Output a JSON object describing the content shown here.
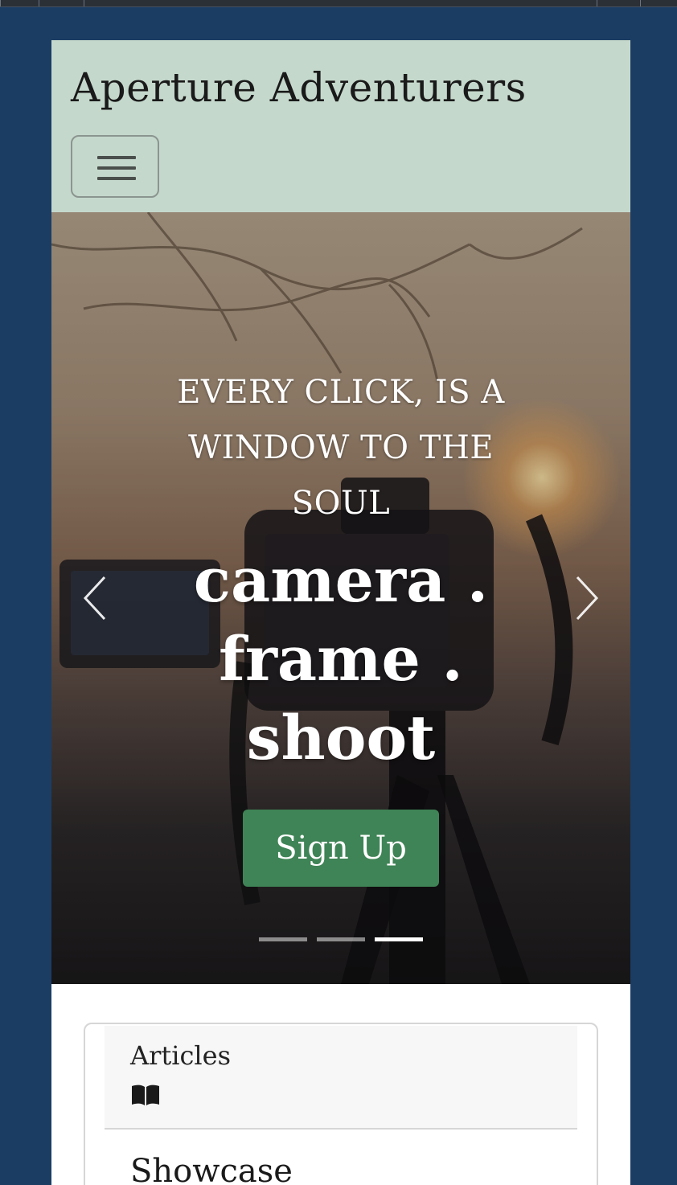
{
  "navbar": {
    "brand": "Aperture Adventurers",
    "toggler_icon": "hamburger-menu-icon"
  },
  "hero": {
    "subtitle": "EVERY CLICK, IS A WINDOW TO THE SOUL",
    "headline": "camera . frame . shoot",
    "cta_label": "Sign Up",
    "prev_icon": "chevron-left-icon",
    "next_icon": "chevron-right-icon",
    "slide_count": 3,
    "active_slide": 3
  },
  "cards": {
    "items": [
      {
        "label": "Articles",
        "icon": "open-book-icon"
      }
    ],
    "next_heading": "Showcase"
  },
  "colors": {
    "page_background": "#1b3d63",
    "navbar_background": "#c5d8cc",
    "cta_background": "#3f8456"
  }
}
